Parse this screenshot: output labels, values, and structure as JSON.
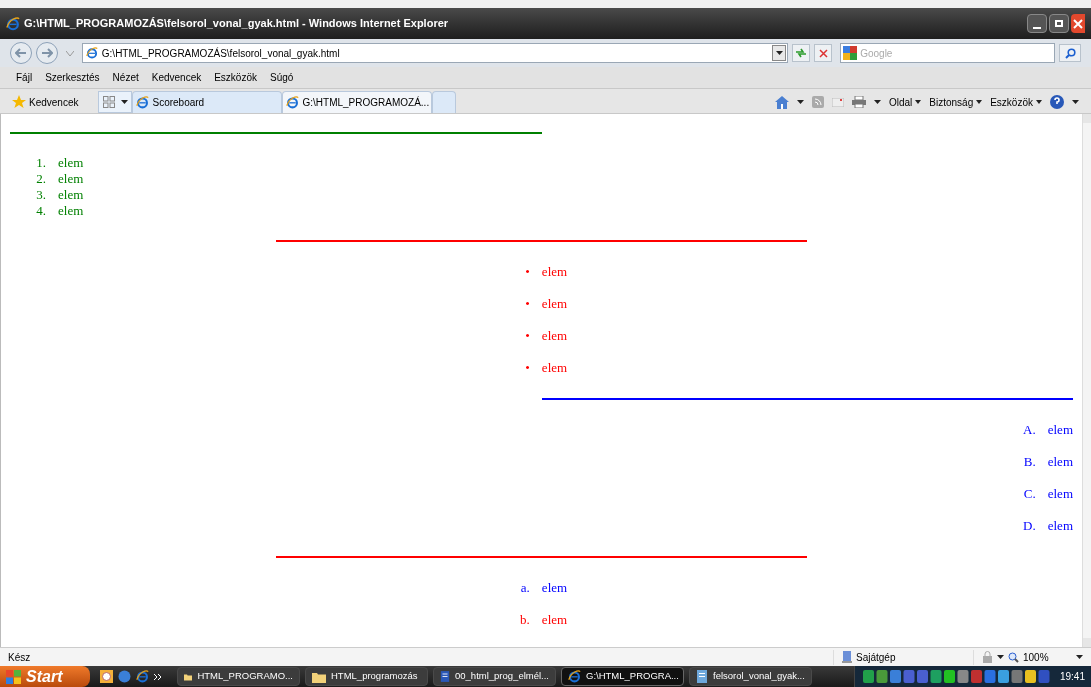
{
  "window": {
    "title": "G:\\HTML_PROGRAMOZÁS\\felsorol_vonal_gyak.html - Windows Internet Explorer"
  },
  "address_bar": {
    "value": "G:\\HTML_PROGRAMOZÁS\\felsorol_vonal_gyak.html"
  },
  "search": {
    "placeholder": "Google"
  },
  "menu": [
    "Fájl",
    "Szerkesztés",
    "Nézet",
    "Kedvencek",
    "Eszközök",
    "Súgó"
  ],
  "favorites": "Kedvencek",
  "tabs": [
    {
      "label": "Scoreboard",
      "selected": false
    },
    {
      "label": "G:\\HTML_PROGRAMOZÁ...",
      "selected": true
    }
  ],
  "command_bar": [
    "Oldal",
    "Biztonság",
    "Eszközök"
  ],
  "content": [
    {
      "kind": "rule",
      "color": "#008000"
    },
    {
      "kind": "list",
      "items": [
        {
          "marker": "1.",
          "text": "elem",
          "color": "#008000"
        },
        {
          "marker": "2.",
          "text": "elem",
          "color": "#008000"
        },
        {
          "marker": "3.",
          "text": "elem",
          "color": "#008000"
        },
        {
          "marker": "4.",
          "text": "elem",
          "color": "#008000"
        }
      ]
    },
    {
      "kind": "rule",
      "color": "#ff0000"
    },
    {
      "kind": "list",
      "items": [
        {
          "marker": "•",
          "text": "elem",
          "color": "#ff0000"
        },
        {
          "marker": "•",
          "text": "elem",
          "color": "#ff0000"
        },
        {
          "marker": "•",
          "text": "elem",
          "color": "#ff0000"
        },
        {
          "marker": "•",
          "text": "elem",
          "color": "#ff0000"
        }
      ]
    },
    {
      "kind": "rule",
      "color": "#0000ff"
    },
    {
      "kind": "list",
      "items": [
        {
          "marker": "A.",
          "text": "elem",
          "color": "#0000ff"
        },
        {
          "marker": "B.",
          "text": "elem",
          "color": "#0000ff"
        },
        {
          "marker": "C.",
          "text": "elem",
          "color": "#0000ff"
        },
        {
          "marker": "D.",
          "text": "elem",
          "color": "#0000ff"
        }
      ]
    },
    {
      "kind": "rule",
      "color": "#ff0000"
    },
    {
      "kind": "list",
      "items": [
        {
          "marker": "a.",
          "text": "elem",
          "color": "#0000ff"
        },
        {
          "marker": "b.",
          "text": "elem",
          "color": "#ff0000"
        }
      ]
    }
  ],
  "status_bar": {
    "text": "Kész",
    "zone": "Sajátgép",
    "zoom": "100%"
  },
  "taskbar": {
    "start": "Start",
    "items": [
      {
        "label": "HTML_PROGRAMO...",
        "selected": false
      },
      {
        "label": "HTML_programozás",
        "selected": false
      },
      {
        "label": "00_html_prog_elmél...",
        "selected": false
      },
      {
        "label": "G:\\HTML_PROGRA...",
        "selected": true
      },
      {
        "label": "felsorol_vonal_gyak...",
        "selected": false
      }
    ],
    "clock": "19:41"
  }
}
